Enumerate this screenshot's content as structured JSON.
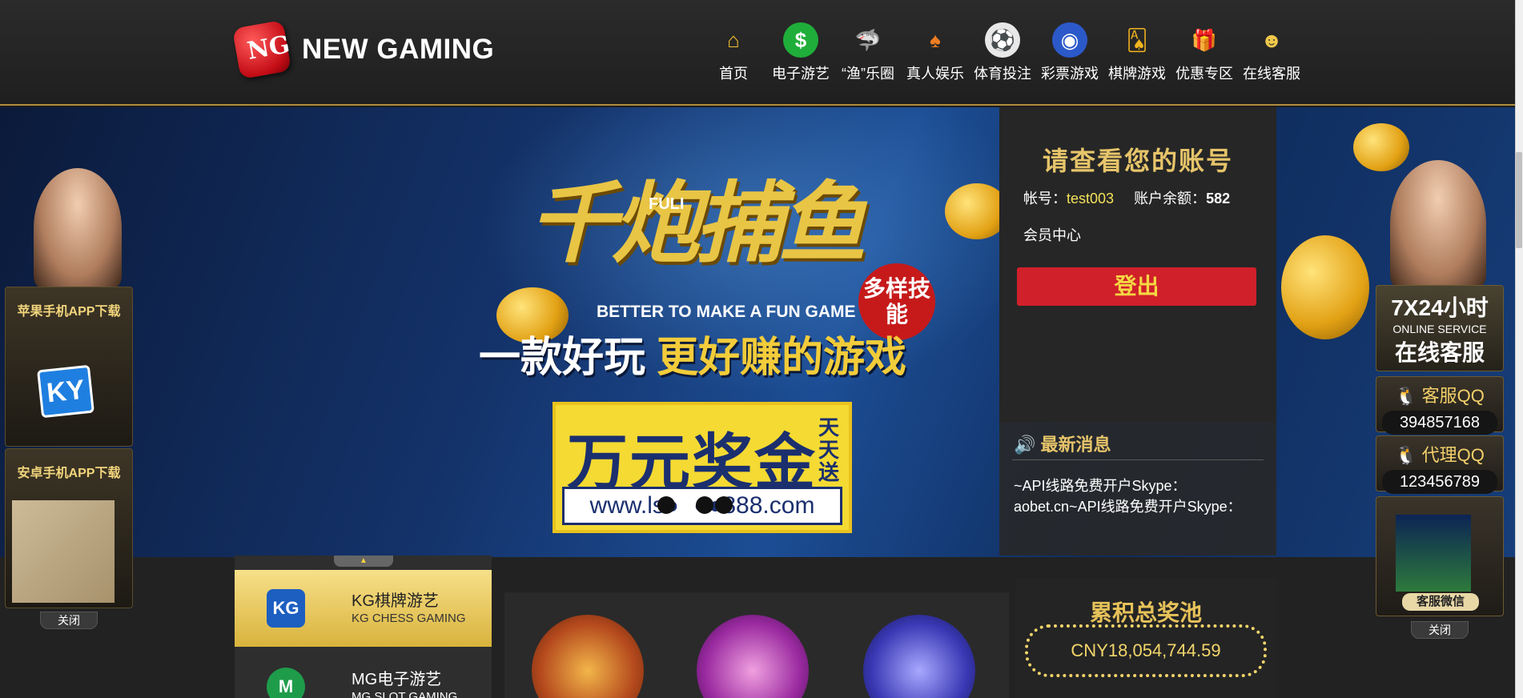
{
  "brand": {
    "logo_mark": "NG",
    "name": "NEW GAMING"
  },
  "nav": [
    {
      "label": "首页",
      "icon": "home-icon",
      "color": "#f3c22f"
    },
    {
      "label": "电子游艺",
      "icon": "dollar-coin-icon",
      "color": "#1fae3a"
    },
    {
      "label": "“渔”乐圈",
      "icon": "shark-icon",
      "color": "#2aa8d6"
    },
    {
      "label": "真人娱乐",
      "icon": "playing-card-icon",
      "color": "#ef7d22"
    },
    {
      "label": "体育投注",
      "icon": "soccer-ball-icon",
      "color": "#e8e8e8"
    },
    {
      "label": "彩票游戏",
      "icon": "lottery-ball-icon",
      "color": "#2c59c9"
    },
    {
      "label": "棋牌游戏",
      "icon": "cards-fan-icon",
      "color": "#f2b41f"
    },
    {
      "label": "优惠专区",
      "icon": "gift-icon",
      "color": "#e0262e"
    },
    {
      "label": "在线客服",
      "icon": "support-agent-icon",
      "color": "#f0c84a"
    }
  ],
  "banner": {
    "brand_badge": "FULI",
    "title": "千炮捕鱼",
    "badge": "多样技能",
    "tagline_en": "BETTER TO MAKE A FUN GAME",
    "slogan_a": "一款好玩",
    "slogan_b": "更好赚的游戏",
    "prize": "万元奖金",
    "prize_side": "天天送",
    "url": "www.ls●○●●888.com",
    "slides": 4,
    "active_slide": 2
  },
  "account": {
    "title": "请查看您的账号",
    "account_label": "帐号：",
    "account_value": "test003",
    "balance_label": "账户余额：",
    "balance_value": "582",
    "member_center": "会员中心",
    "logout": "登出"
  },
  "news": {
    "title": "最新消息",
    "body": "~API线路免费开户Skype：aobet.cn~API线路免费开户Skype："
  },
  "game_list": [
    {
      "name": "KG棋牌游艺",
      "sub": "KG CHESS GAMING",
      "icon": "KG"
    },
    {
      "name": "MG电子游艺",
      "sub": "MG SLOT GAMING",
      "icon": "M"
    }
  ],
  "jackpot": {
    "title": "累积总奖池",
    "value": "CNY18,054,744.59"
  },
  "left_side": {
    "ios_title": "苹果手机APP下载",
    "ky_logo": "KY",
    "android_title": "安卓手机APP下载",
    "close": "关闭"
  },
  "right_side": {
    "hours": "7X24小时",
    "online_en": "ONLINE SERVICE",
    "online_cn": "在线客服",
    "qq1_label": "客服QQ",
    "qq1_value": "394857168",
    "qq2_label": "代理QQ",
    "qq2_value": "123456789",
    "wechat": "客服微信",
    "close": "关闭"
  }
}
